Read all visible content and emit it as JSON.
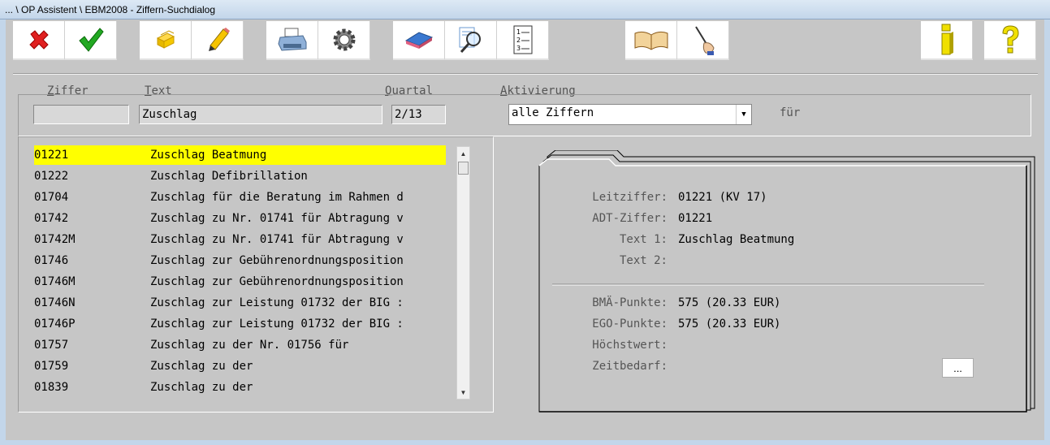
{
  "window": {
    "title": "... \\ OP Assistent \\ EBM2008 - Ziffern-Suchdialog"
  },
  "toolbar": [
    {
      "name": "cancel-button",
      "icon": "red-x-icon"
    },
    {
      "name": "ok-button",
      "icon": "green-check-icon"
    },
    {
      "name": "copy-button",
      "icon": "stack-icon"
    },
    {
      "name": "edit-button",
      "icon": "pencil-icon"
    },
    {
      "name": "print-button",
      "icon": "printer-icon"
    },
    {
      "name": "settings-button",
      "icon": "gear-icon"
    },
    {
      "name": "clear-button",
      "icon": "eraser-icon"
    },
    {
      "name": "search-button",
      "icon": "magnifier-icon"
    },
    {
      "name": "list-button",
      "icon": "numbered-list-icon"
    },
    {
      "name": "book-button",
      "icon": "book-icon"
    },
    {
      "name": "write-button",
      "icon": "hand-pen-icon"
    },
    {
      "name": "info-button",
      "icon": "info-icon"
    },
    {
      "name": "help-button",
      "icon": "question-icon"
    }
  ],
  "search": {
    "ziffer_label_first": "Z",
    "ziffer_label_rest": "iffer",
    "text_label_first": "T",
    "text_label_rest": "ext",
    "quartal_label_first": "Q",
    "quartal_label_rest": "uartal",
    "aktivierung_label_first": "A",
    "aktivierung_label_rest": "ktivierung",
    "ziffer_value": "",
    "text_value": "Zuschlag",
    "quartal_value": "2/13",
    "aktivierung_value": "alle Ziffern",
    "fuer_label": "für"
  },
  "results": [
    {
      "code": "01221",
      "text": "Zuschlag Beatmung"
    },
    {
      "code": "01222",
      "text": "Zuschlag Defibrillation"
    },
    {
      "code": "01704",
      "text": "Zuschlag für die Beratung im Rahmen d"
    },
    {
      "code": "01742",
      "text": "Zuschlag zu Nr. 01741 für Abtragung v"
    },
    {
      "code": "01742M",
      "text": "Zuschlag zu Nr. 01741 für Abtragung v"
    },
    {
      "code": "01746",
      "text": "Zuschlag zur Gebührenordnungsposition"
    },
    {
      "code": "01746M",
      "text": "Zuschlag zur Gebührenordnungsposition"
    },
    {
      "code": "01746N",
      "text": "Zuschlag zur Leistung 01732 der BIG :"
    },
    {
      "code": "01746P",
      "text": "Zuschlag zur Leistung 01732 der BIG :"
    },
    {
      "code": "01757",
      "text": "Zuschlag zu der Nr. 01756 für"
    },
    {
      "code": "01759",
      "text": "Zuschlag zu der"
    },
    {
      "code": "01839",
      "text": "Zuschlag zu der"
    }
  ],
  "selected_index": 0,
  "colors": {
    "selection": "#ffff00",
    "background": "#c6c6c6"
  },
  "detail": {
    "leitziffer_label": "Leitziffer:",
    "leitziffer_value": "01221 (KV 17)",
    "adt_label": "ADT-Ziffer:",
    "adt_value": "01221",
    "text1_label": "Text 1:",
    "text1_value": "Zuschlag Beatmung",
    "text2_label": "Text 2:",
    "text2_value": "",
    "bma_label": "BMÄ-Punkte:",
    "bma_value": "575 (20.33 EUR)",
    "ego_label": "EGO-Punkte:",
    "ego_value": "575 (20.33 EUR)",
    "hoechst_label": "Höchstwert:",
    "hoechst_value": "",
    "zeit_label": "Zeitbedarf:",
    "more_label": "..."
  }
}
